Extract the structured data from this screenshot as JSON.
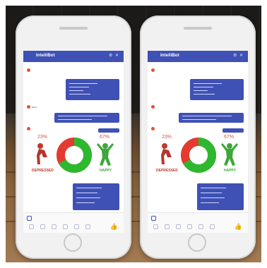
{
  "phones": [
    {
      "title": "IntelliBot",
      "bot_labels": [
        "",
        "Blake",
        ""
      ],
      "stats": {
        "left_value": "23%",
        "right_value": "67%",
        "left_label": "DEPRESSED",
        "right_label": "HAPPY"
      },
      "donut": {
        "green_fraction": 0.67
      }
    },
    {
      "title": "IntelliBot",
      "bot_labels": [
        "",
        "",
        ""
      ],
      "stats": {
        "left_value": "23%",
        "right_value": "67%",
        "left_label": "DEPRESSED",
        "right_label": "HAPPY"
      },
      "donut": {
        "green_fraction": 0.67
      }
    }
  ],
  "colors": {
    "header": "#3f51b5",
    "bubble": "#3f51b5",
    "positive": "#2eb82e",
    "negative": "#e43a2f",
    "bot_icon": "#e0533b"
  }
}
